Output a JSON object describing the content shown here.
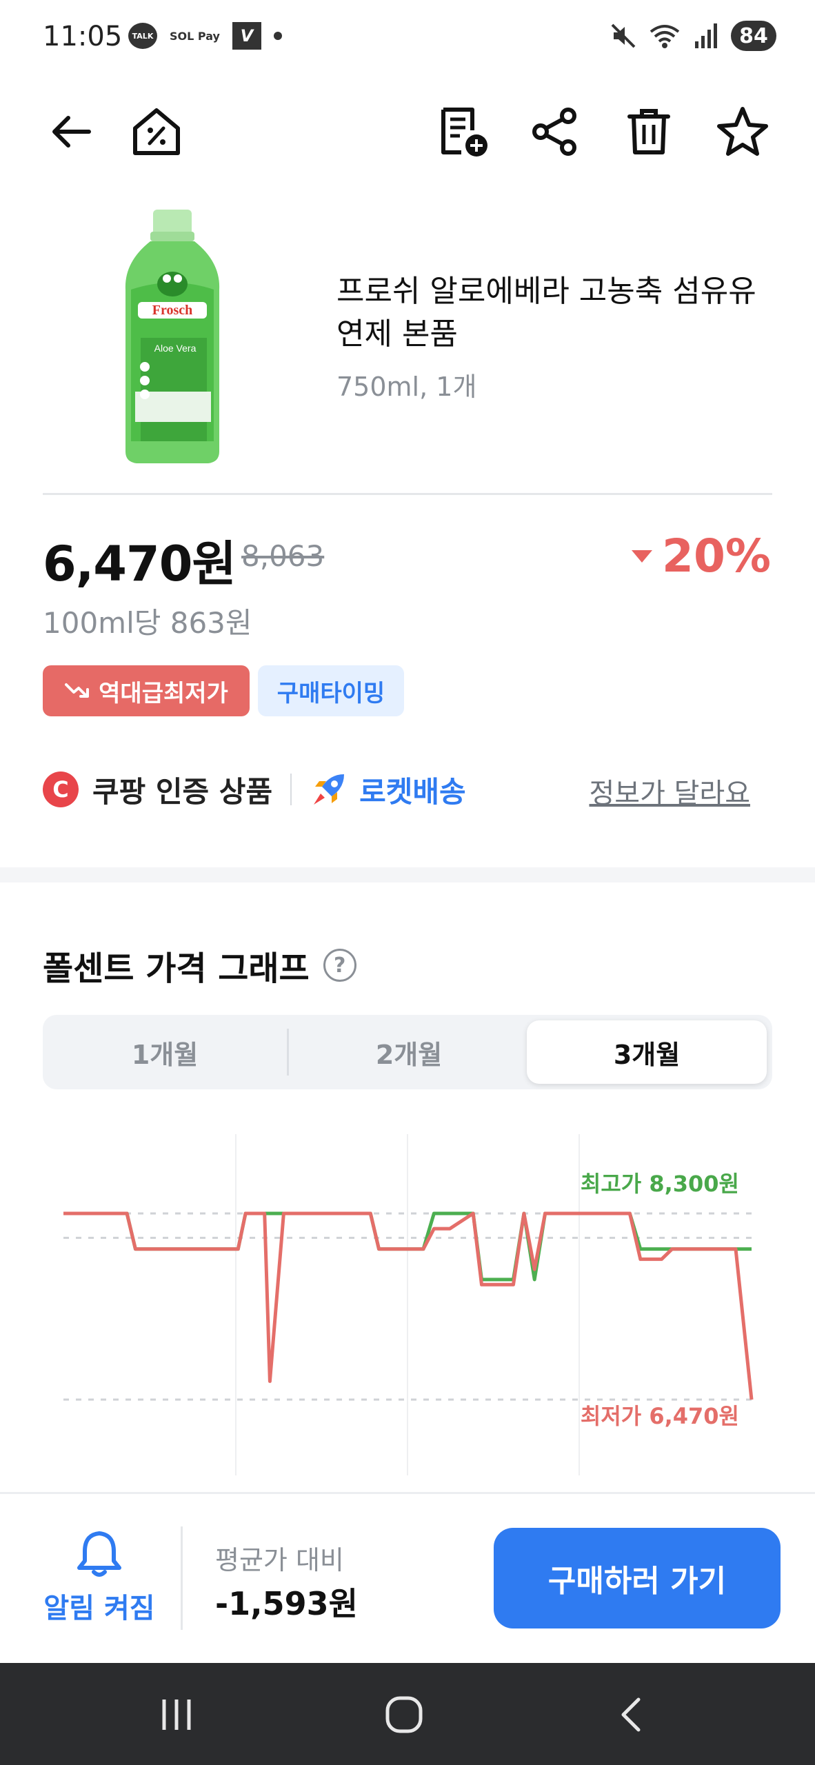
{
  "status_bar": {
    "time": "11:05",
    "talk_icon_label": "TALK",
    "solpay_label": "SOL Pay",
    "v_icon_label": "V",
    "battery": "84"
  },
  "toolbar": {
    "icons": [
      "back-arrow-icon",
      "discount-house-icon",
      "add-to-list-icon",
      "share-icon",
      "trash-icon",
      "star-icon"
    ]
  },
  "product": {
    "name": "프로쉬 알로에베라 고농축 섬유유연제 본품",
    "spec": "750ml, 1개",
    "brand_on_label": "Frosch",
    "variant_on_label": "Aloe Vera"
  },
  "price": {
    "current": "6,470원",
    "original": "8,063",
    "discount": "20%",
    "unit_price": "100ml당 863원"
  },
  "badges": {
    "lowest": "역대급최저가",
    "timing": "구매타이밍"
  },
  "certification": {
    "coupang_logo": "C",
    "coupang_verified": "쿠팡 인증 상품",
    "rocket": "로켓배송",
    "info_link": "정보가 달라요"
  },
  "graph": {
    "title": "폴센트 가격 그래프",
    "help": "?",
    "tabs": [
      {
        "label": "1개월",
        "active": false
      },
      {
        "label": "2개월",
        "active": false
      },
      {
        "label": "3개월",
        "active": true
      }
    ]
  },
  "chart_data": {
    "type": "line",
    "max_label": "최고가 8,300원",
    "min_label": "최저가 6,470원",
    "ylim": [
      6300,
      8450
    ],
    "x": [
      0,
      6,
      6.8,
      16.5,
      17.2,
      19,
      19.5,
      20.8,
      29,
      29.8,
      34,
      35,
      36.5,
      38.7,
      39.5,
      42.5,
      43.5,
      44.5,
      45.5,
      48.5,
      53.5,
      54.5,
      56.5,
      57.5,
      61,
      61.5,
      63.5,
      65
    ],
    "series": [
      {
        "color": "#e46e69",
        "values": [
          8300,
          8300,
          7950,
          7950,
          8300,
          8300,
          6650,
          8300,
          8300,
          7950,
          7950,
          8150,
          8150,
          8300,
          7600,
          7600,
          8300,
          7750,
          8300,
          8300,
          8300,
          7850,
          7850,
          7950,
          7950,
          7950,
          7950,
          6470
        ]
      },
      {
        "color": "#4caf50",
        "values": [
          8300,
          8300,
          7950,
          7950,
          8300,
          8300,
          8300,
          8300,
          8300,
          7950,
          7950,
          8300,
          8300,
          8300,
          7650,
          7650,
          8300,
          7650,
          8300,
          8300,
          8300,
          7950,
          7950,
          7950,
          7950,
          7950,
          7950,
          7950
        ]
      }
    ],
    "reference_lines": [
      8300,
      8060,
      6470
    ],
    "grid": "vertical"
  },
  "bottom": {
    "alarm_label": "알림 켜짐",
    "avg_label": "평균가 대비",
    "avg_value": "-1,593원",
    "buy_label": "구매하러 가기"
  },
  "nav": {
    "icons": [
      "recent-apps-icon",
      "home-icon",
      "back-icon"
    ]
  }
}
